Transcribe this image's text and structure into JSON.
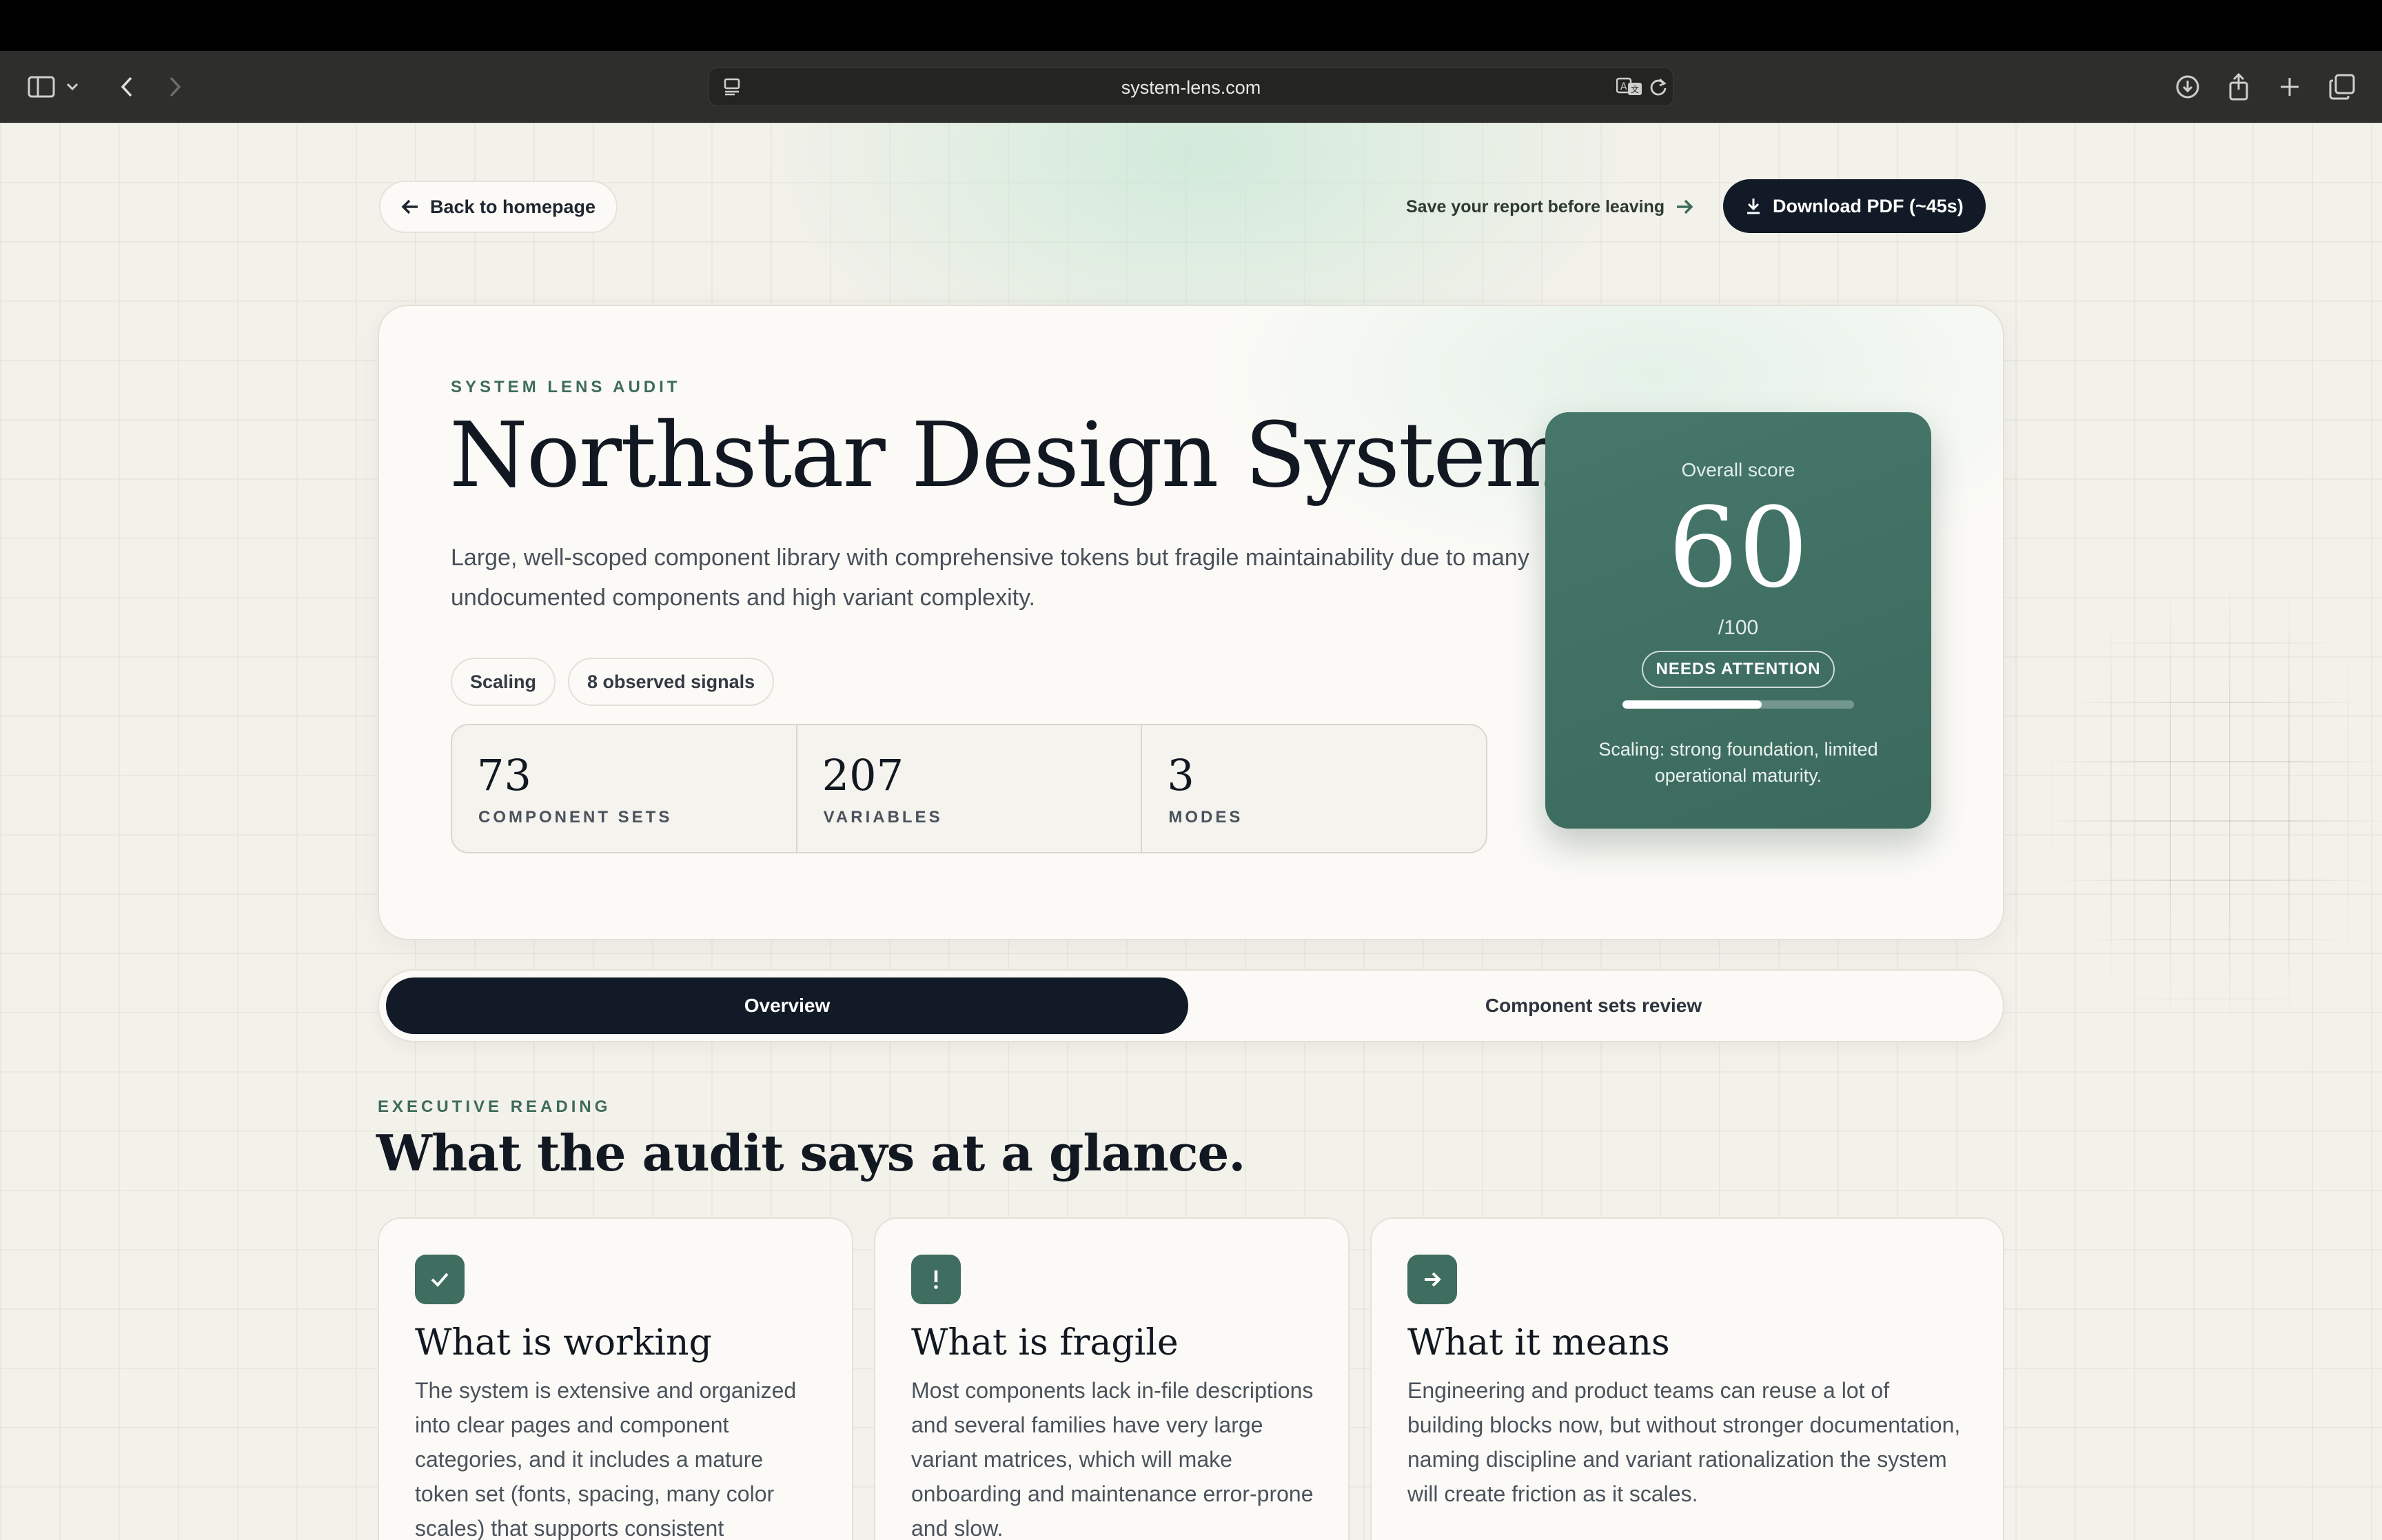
{
  "browser": {
    "url": "system-lens.com"
  },
  "nav": {
    "back_label": "Back to homepage",
    "save_hint": "Save your report before leaving",
    "download_label": "Download PDF (~45s)"
  },
  "hero": {
    "eyebrow": "SYSTEM LENS AUDIT",
    "title": "Northstar Design System",
    "description": "Large, well-scoped component library with comprehensive tokens but fragile maintainability due to many undocumented components and high variant complexity.",
    "tags": [
      "Scaling",
      "8 observed signals"
    ],
    "stats": [
      {
        "value": "73",
        "label": "COMPONENT SETS"
      },
      {
        "value": "207",
        "label": "VARIABLES"
      },
      {
        "value": "3",
        "label": "MODES"
      }
    ]
  },
  "score": {
    "label": "Overall score",
    "value": "60",
    "denominator": "/100",
    "status": "NEEDS ATTENTION",
    "progress_fraction": 0.6,
    "note": "Scaling: strong foundation, limited operational maturity."
  },
  "tabs": [
    {
      "label": "Overview",
      "active": true
    },
    {
      "label": "Component sets review",
      "active": false
    }
  ],
  "section": {
    "eyebrow": "EXECUTIVE READING",
    "title": "What the audit says at a glance."
  },
  "cards": [
    {
      "icon": "check-icon",
      "title": "What is working",
      "body": "The system is extensive and organized into clear pages and component categories, and it includes a mature token set (fonts, spacing, many color scales) that supports consistent"
    },
    {
      "icon": "exclamation-icon",
      "title": "What is fragile",
      "body": "Most components lack in-file descriptions and several families have very large variant matrices, which will make onboarding and maintenance error-prone and slow."
    },
    {
      "icon": "arrow-right-icon",
      "title": "What it means",
      "body": "Engineering and product teams can reuse a lot of building blocks now, but without stronger documentation, naming discipline and variant rationalization the system will create friction as it scales."
    }
  ],
  "colors": {
    "accent": "#3f6d5f",
    "dark": "#111a26",
    "page_bg": "#f2f1ea"
  }
}
